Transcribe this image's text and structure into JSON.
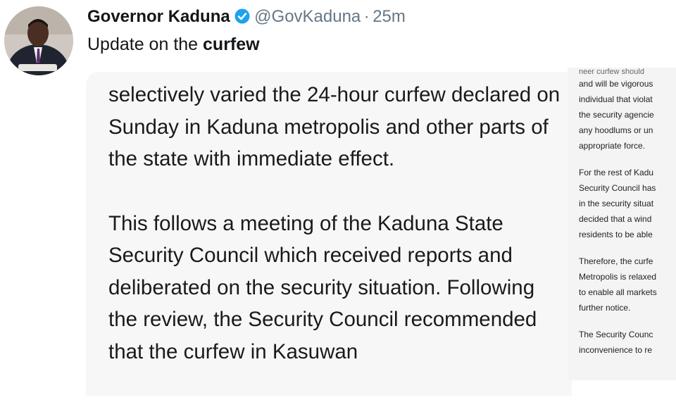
{
  "tweet": {
    "author_name": "Governor Kaduna",
    "handle": "@GovKaduna",
    "separator": "·",
    "time": "25m",
    "status_prefix": "Update on the ",
    "status_keyword": "curfew",
    "verified_color": "#1da1f2"
  },
  "document_main": {
    "paragraph_1": "selectively varied the 24-hour curfew declared on Sunday in Kaduna metropolis and other parts of the state with immediate effect.",
    "paragraph_2": "This follows a meeting of the Kaduna State Security Council which received reports and deliberated on the security situation. Following the review, the Security Council recommended that the curfew in Kasuwan"
  },
  "document_side": {
    "cut_top": "neer curfew should",
    "paragraphs": [
      [
        "and will be vigorous",
        "individual that violat",
        "the security agencie",
        "any hoodlums or un",
        "appropriate force."
      ],
      [
        "For the rest of Kadu",
        "Security Council has",
        "in the security situat",
        "decided that a wind",
        "residents to be able"
      ],
      [
        "Therefore, the curfe",
        "Metropolis is relaxed",
        "to enable all markets",
        "further notice."
      ],
      [
        "The Security Counc",
        "inconvenience to re"
      ]
    ]
  }
}
